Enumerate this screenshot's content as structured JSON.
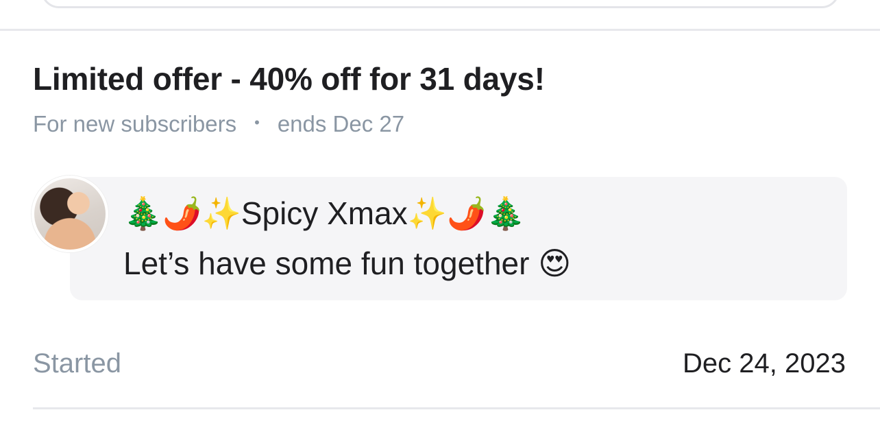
{
  "offer": {
    "title": "Limited offer - 40% off for 31 days!",
    "audience": "For new subscribers",
    "separator": "•",
    "ends": "ends Dec 27"
  },
  "message": {
    "line1": "🎄🌶️✨Spicy Xmax✨🌶️🎄",
    "line2": "Let’s have some fun together 😍"
  },
  "started": {
    "label": "Started",
    "date": "Dec 24, 2023"
  },
  "colors": {
    "title": "#1f1f22",
    "muted": "#8a96a3",
    "bubble": "#f5f5f7",
    "divider": "#e7e8ec"
  }
}
